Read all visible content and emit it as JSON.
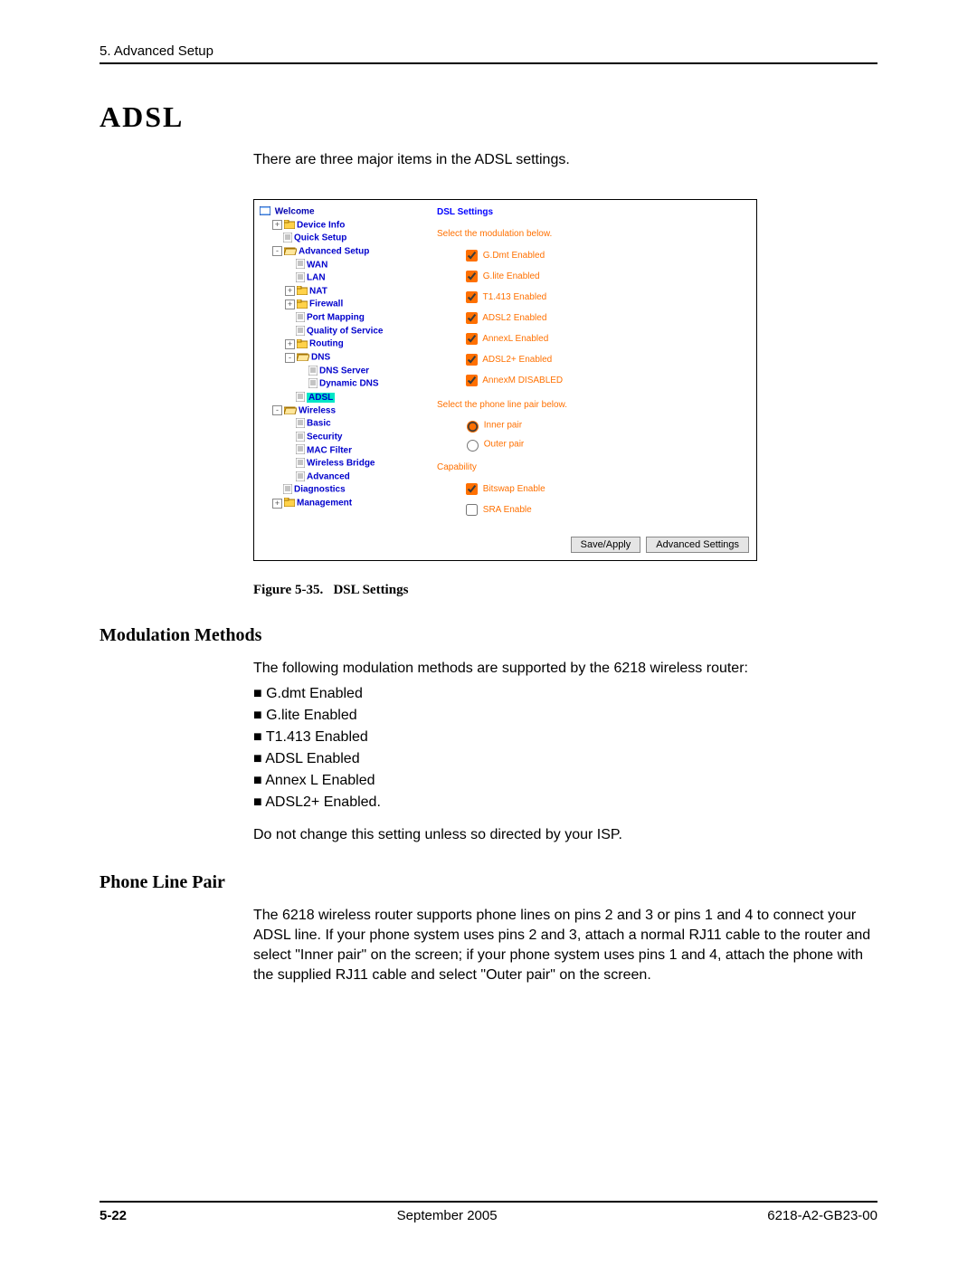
{
  "header": {
    "chapter": "5. Advanced Setup"
  },
  "title": "ADSL",
  "intro": "There are three major items in the ADSL settings.",
  "figure": {
    "caption_prefix": "Figure 5-35.",
    "caption_text": "DSL Settings",
    "dsl_panel": {
      "title": "DSL Settings",
      "mod_label": "Select the modulation below.",
      "modulations": [
        {
          "label": "G.Dmt Enabled",
          "checked": true
        },
        {
          "label": "G.lite Enabled",
          "checked": true
        },
        {
          "label": "T1.413 Enabled",
          "checked": true
        },
        {
          "label": "ADSL2 Enabled",
          "checked": true
        },
        {
          "label": "AnnexL Enabled",
          "checked": true
        },
        {
          "label": "ADSL2+ Enabled",
          "checked": true
        },
        {
          "label": "AnnexM DISABLED",
          "checked": true
        }
      ],
      "pair_label": "Select the phone line pair below.",
      "pairs": [
        {
          "label": "Inner pair",
          "selected": true
        },
        {
          "label": "Outer pair",
          "selected": false
        }
      ],
      "cap_label": "Capability",
      "capabilities": [
        {
          "label": "Bitswap Enable",
          "checked": true
        },
        {
          "label": "SRA Enable",
          "checked": false
        }
      ],
      "buttons": {
        "save": "Save/Apply",
        "advanced": "Advanced Settings"
      }
    },
    "tree": {
      "welcome": "Welcome",
      "items": [
        {
          "depth": 1,
          "expander": "+",
          "icon": "folder-closed",
          "label": "Device Info",
          "bold": true
        },
        {
          "depth": 1,
          "expander": "",
          "icon": "file",
          "label": "Quick Setup",
          "bold": true
        },
        {
          "depth": 1,
          "expander": "-",
          "icon": "folder-open",
          "label": "Advanced Setup",
          "bold": true
        },
        {
          "depth": 2,
          "expander": "",
          "icon": "file",
          "label": "WAN",
          "bold": true
        },
        {
          "depth": 2,
          "expander": "",
          "icon": "file",
          "label": "LAN",
          "bold": true
        },
        {
          "depth": 2,
          "expander": "+",
          "icon": "folder-closed",
          "label": "NAT",
          "bold": true
        },
        {
          "depth": 2,
          "expander": "+",
          "icon": "folder-closed",
          "label": "Firewall",
          "bold": true
        },
        {
          "depth": 2,
          "expander": "",
          "icon": "file",
          "label": "Port Mapping",
          "bold": true
        },
        {
          "depth": 2,
          "expander": "",
          "icon": "file",
          "label": "Quality of Service",
          "bold": true
        },
        {
          "depth": 2,
          "expander": "+",
          "icon": "folder-closed",
          "label": "Routing",
          "bold": true
        },
        {
          "depth": 2,
          "expander": "-",
          "icon": "folder-open",
          "label": "DNS",
          "bold": true
        },
        {
          "depth": 3,
          "expander": "",
          "icon": "file",
          "label": "DNS Server",
          "bold": true
        },
        {
          "depth": 3,
          "expander": "",
          "icon": "file",
          "label": "Dynamic DNS",
          "bold": true
        },
        {
          "depth": 2,
          "expander": "",
          "icon": "file",
          "label": "ADSL",
          "bold": true,
          "highlight": true
        },
        {
          "depth": 1,
          "expander": "-",
          "icon": "folder-open",
          "label": "Wireless",
          "bold": true
        },
        {
          "depth": 2,
          "expander": "",
          "icon": "file",
          "label": "Basic",
          "bold": true
        },
        {
          "depth": 2,
          "expander": "",
          "icon": "file",
          "label": "Security",
          "bold": true
        },
        {
          "depth": 2,
          "expander": "",
          "icon": "file",
          "label": "MAC Filter",
          "bold": true
        },
        {
          "depth": 2,
          "expander": "",
          "icon": "file",
          "label": "Wireless Bridge",
          "bold": true
        },
        {
          "depth": 2,
          "expander": "",
          "icon": "file",
          "label": "Advanced",
          "bold": true
        },
        {
          "depth": 1,
          "expander": "",
          "icon": "file",
          "label": "Diagnostics",
          "bold": true
        },
        {
          "depth": 1,
          "expander": "+",
          "icon": "folder-closed",
          "label": "Management",
          "bold": true
        }
      ]
    }
  },
  "modulation_section": {
    "heading": "Modulation Methods",
    "intro": "The following modulation methods are supported by the 6218 wireless router:",
    "bullets": [
      "G.dmt Enabled",
      "G.lite Enabled",
      "T1.413 Enabled",
      "ADSL Enabled",
      "Annex L Enabled",
      "ADSL2+ Enabled."
    ],
    "note": "Do not change this setting unless so directed by your ISP."
  },
  "phone_section": {
    "heading": "Phone Line Pair",
    "body": "The 6218 wireless router supports phone lines on pins 2 and 3 or pins 1 and 4 to connect your ADSL line. If your phone system uses pins 2 and 3, attach a normal RJ11 cable to the router and select \"Inner pair\" on the screen; if your phone system uses pins 1 and 4, attach the phone with the supplied RJ11 cable and select \"Outer pair\" on the screen."
  },
  "footer": {
    "page": "5-22",
    "date": "September 2005",
    "docid": "6218-A2-GB23-00"
  }
}
